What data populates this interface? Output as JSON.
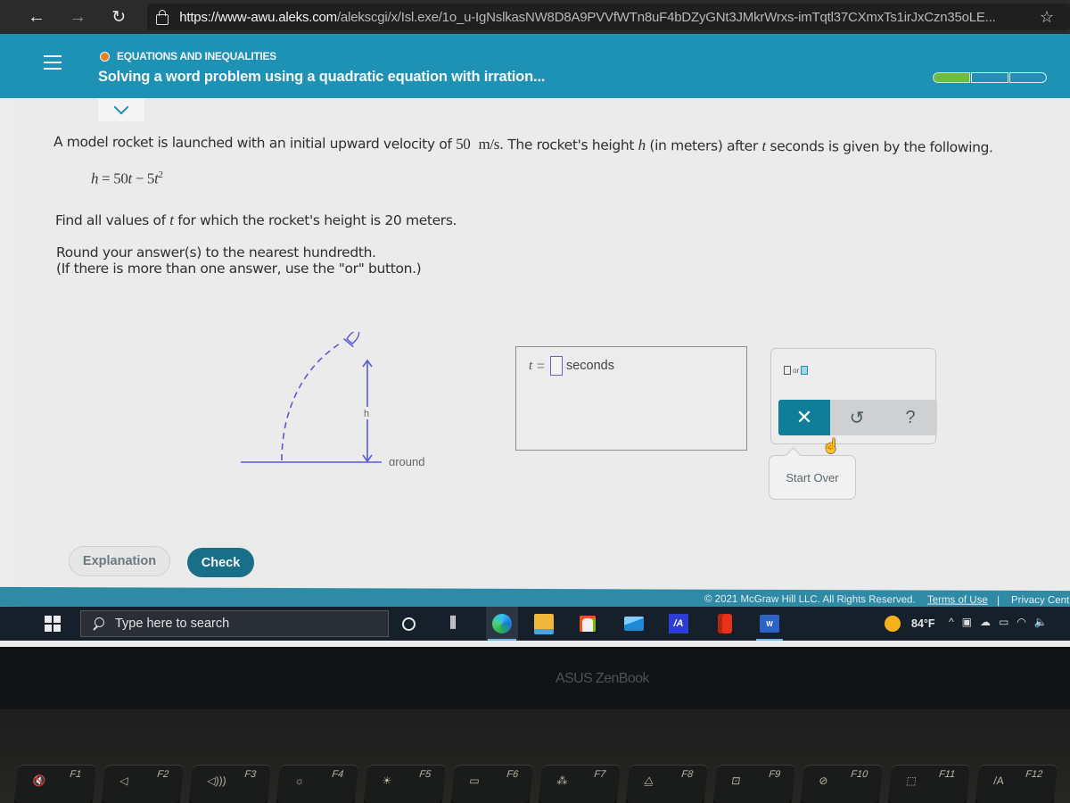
{
  "browser": {
    "url_host": "https://www-awu.aleks.com",
    "url_path": "/alekscgi/x/Isl.exe/1o_u-IgNslkasNW8D8A9PVVfWTn8uF4bDZyGNt3JMkrWrxs-imTqtl37CXmxTs1irJxCzn35oLE...",
    "icons": {
      "back": "←",
      "forward": "→",
      "refresh": "↻",
      "favorite": "☆"
    }
  },
  "header": {
    "topic_label": "EQUATIONS AND INEQUALITIES",
    "topic_title": "Solving a word problem using a quadratic equation with irration...",
    "topic_dot_color": "#e7801f",
    "progress": {
      "segments_total": 3,
      "segments_complete": 1
    }
  },
  "question": {
    "line1_pre": "A model rocket is launched with an initial upward velocity of ",
    "velocity_value": "50",
    "velocity_unit": "m/s",
    "line1_mid": ". The rocket's height ",
    "var_h": "h",
    "line1_mid2": " (in meters) after ",
    "var_t": "t",
    "line1_post": " seconds is given by the following.",
    "equation_lhs": "h",
    "equation_eq": " = 50",
    "equation_t1": "t",
    "equation_minus": " − 5",
    "equation_t2": "t",
    "equation_exp": "2",
    "line3_pre": "Find all values of ",
    "line3_var": "t",
    "line3_post": " for which the rocket's height is 20 meters.",
    "line4": "Round your answer(s) to the nearest hundredth.",
    "line5": "(If there is more than one answer, use the \"or\" button.)"
  },
  "diagram": {
    "h_label": "h",
    "ground_label": "ground"
  },
  "answer": {
    "variable": "t",
    "equals": "=",
    "value": "",
    "unit": "seconds"
  },
  "tools": {
    "or_label": "or",
    "clear_symbol": "✕",
    "undo_symbol": "↺",
    "help_symbol": "?",
    "tooltip": "Start Over"
  },
  "buttons": {
    "explanation": "Explanation",
    "check": "Check"
  },
  "footer": {
    "copyright": "© 2021 McGraw Hill LLC. All Rights Reserved.",
    "terms": "Terms of Use",
    "separator": "|",
    "privacy": "Privacy Cent"
  },
  "taskbar": {
    "search_placeholder": "Type here to search",
    "taskview_symbol": "⫼",
    "weather_temp": "84°F",
    "tray": [
      "^",
      "▣",
      "☁",
      "▭",
      "◠",
      "🔈"
    ]
  },
  "device": {
    "brand": "ASUS ZenBook",
    "fkeys": [
      {
        "label": "F1",
        "glyph": "🔇"
      },
      {
        "label": "F2",
        "glyph": "◁"
      },
      {
        "label": "F3",
        "glyph": "◁)))"
      },
      {
        "label": "F4",
        "glyph": "☼"
      },
      {
        "label": "F5",
        "glyph": "☀"
      },
      {
        "label": "F6",
        "glyph": "▭"
      },
      {
        "label": "F7",
        "glyph": "⁂"
      },
      {
        "label": "F8",
        "glyph": "⧋"
      },
      {
        "label": "F9",
        "glyph": "⊡"
      },
      {
        "label": "F10",
        "glyph": "⊘"
      },
      {
        "label": "F11",
        "glyph": "⬚"
      },
      {
        "label": "F12",
        "glyph": "/A"
      }
    ]
  }
}
